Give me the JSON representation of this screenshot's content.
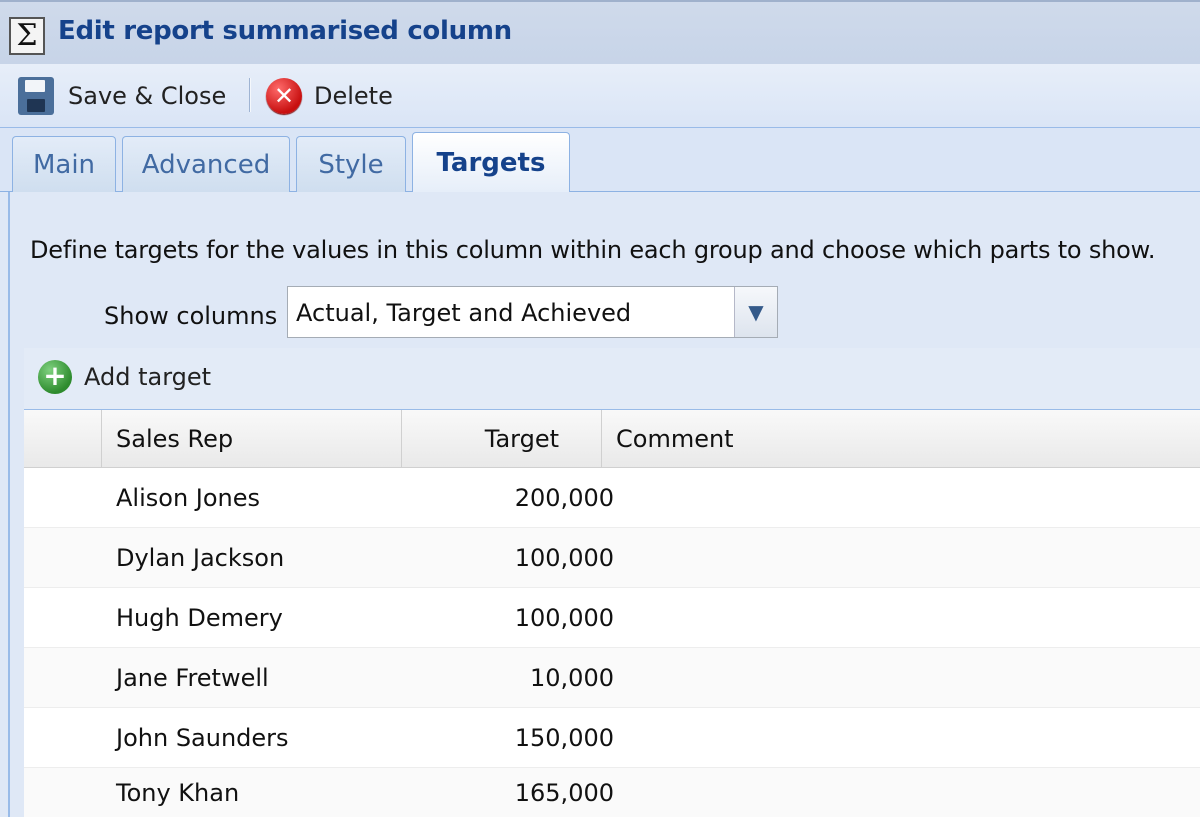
{
  "window": {
    "title": "Edit report summarised column"
  },
  "toolbar": {
    "save_label": "Save & Close",
    "delete_label": "Delete"
  },
  "tabs": [
    {
      "label": "Main",
      "active": false
    },
    {
      "label": "Advanced",
      "active": false
    },
    {
      "label": "Style",
      "active": false
    },
    {
      "label": "Targets",
      "active": true
    }
  ],
  "targets": {
    "description": "Define targets for the values in this column within each group and choose which parts to show.",
    "show_columns_label": "Show columns",
    "show_columns_value": "Actual, Target and Achieved",
    "add_target_label": "Add target"
  },
  "grid": {
    "columns": [
      "Sales Rep",
      "Target",
      "Comment"
    ],
    "rows": [
      {
        "rep": "Alison Jones",
        "target": "200,000",
        "comment": ""
      },
      {
        "rep": "Dylan Jackson",
        "target": "100,000",
        "comment": ""
      },
      {
        "rep": "Hugh Demery",
        "target": "100,000",
        "comment": ""
      },
      {
        "rep": "Jane Fretwell",
        "target": "10,000",
        "comment": ""
      },
      {
        "rep": "John Saunders",
        "target": "150,000",
        "comment": ""
      },
      {
        "rep": "Tony Khan",
        "target": "165,000",
        "comment": ""
      }
    ]
  },
  "icons": {
    "title": "sigma-icon",
    "save": "floppy-disk-icon",
    "delete": "delete-icon",
    "add": "add-icon",
    "combo": "chevron-down-icon"
  },
  "colors": {
    "title_text": "#15428b",
    "panel_bg": "#dfe8f6",
    "border": "#99bbe8"
  }
}
